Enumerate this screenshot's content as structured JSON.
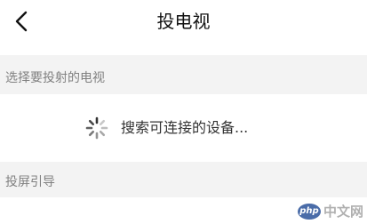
{
  "header": {
    "title": "投电视",
    "back_icon": "chevron-left-icon"
  },
  "sections": {
    "select_tv": {
      "label": "选择要投射的电视"
    },
    "guide": {
      "label": "投屏引导"
    }
  },
  "search": {
    "status_text": "搜索可连接的设备...",
    "spinner_icon": "loading-spinner-icon"
  },
  "watermark": {
    "logo_text": "php",
    "site_text": "中文网"
  },
  "colors": {
    "section_background": "#f3f3f3",
    "section_label": "#808080",
    "watermark_logo": "#4a6ca8"
  }
}
